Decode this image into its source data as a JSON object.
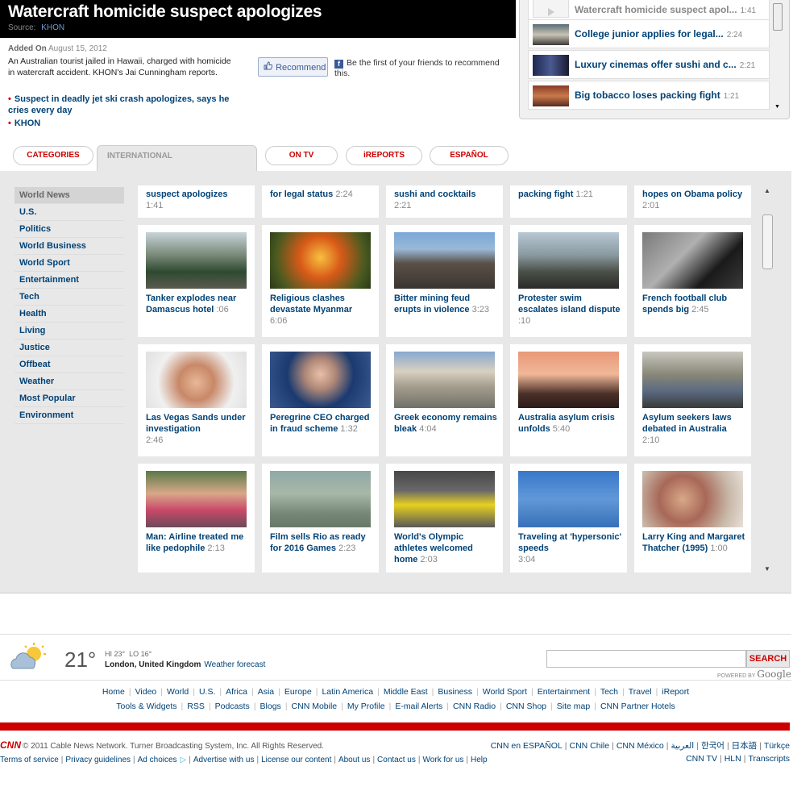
{
  "video": {
    "title": "Watercraft homicide suspect apologizes",
    "source_label": "Source:",
    "source": "KHON",
    "added_label": "Added On",
    "added_date": "August 15, 2012",
    "description": "An Australian tourist jailed in Hawaii, charged with homicide in watercraft accident. KHON's Jai Cunningham reports.",
    "related": [
      "Suspect in deadly jet ski crash apologizes, says he cries every day",
      "KHON"
    ],
    "recommend_label": "Recommend",
    "fb_text": "Be the first of your friends to recommend this."
  },
  "playlist": [
    {
      "title": "Watercraft homicide suspect apol...",
      "duration": "1:41"
    },
    {
      "title": "College junior applies for legal...",
      "duration": "2:24"
    },
    {
      "title": "Luxury cinemas offer sushi and c...",
      "duration": "2:21"
    },
    {
      "title": "Big tobacco loses packing fight",
      "duration": "1:21"
    }
  ],
  "tabs": [
    "CATEGORIES",
    "INTERNATIONAL",
    "ON TV",
    "iREPORTS",
    "ESPAÑOL"
  ],
  "side_nav": [
    "World News",
    "U.S.",
    "Politics",
    "World Business",
    "World Sport",
    "Entertainment",
    "Tech",
    "Health",
    "Living",
    "Justice",
    "Offbeat",
    "Weather",
    "Most Popular",
    "Environment"
  ],
  "partial_row": [
    {
      "title": "suspect apologizes",
      "duration": "1:41"
    },
    {
      "title": "for legal status",
      "duration": "2:24"
    },
    {
      "title": "sushi and cocktails",
      "duration": "2:21"
    },
    {
      "title": "packing fight",
      "duration": "1:21"
    },
    {
      "title": "hopes on Obama policy",
      "duration": "2:01"
    }
  ],
  "videos": [
    {
      "title": "Tanker explodes near Damascus hotel",
      "duration": ":06"
    },
    {
      "title": "Religious clashes devastate Myanmar",
      "duration": "6:06"
    },
    {
      "title": "Bitter mining feud erupts in violence",
      "duration": "3:23"
    },
    {
      "title": "Protester swim escalates island dispute",
      "duration": ":10"
    },
    {
      "title": "French football club spends big",
      "duration": "2:45"
    },
    {
      "title": "Las Vegas Sands under investigation",
      "duration": "2:46"
    },
    {
      "title": "Peregrine CEO charged in fraud scheme",
      "duration": "1:32"
    },
    {
      "title": "Greek economy remains bleak",
      "duration": "4:04"
    },
    {
      "title": "Australia asylum crisis unfolds",
      "duration": "5:40"
    },
    {
      "title": "Asylum seekers laws debated in Australia",
      "duration": "2:10"
    },
    {
      "title": "Man: Airline treated me like pedophile",
      "duration": "2:13"
    },
    {
      "title": "Film sells Rio as ready for 2016 Games",
      "duration": "2:23"
    },
    {
      "title": "World's Olympic athletes welcomed home",
      "duration": "2:03"
    },
    {
      "title": "Traveling at 'hypersonic' speeds",
      "duration": "3:04"
    },
    {
      "title": "Larry King and Margaret Thatcher (1995)",
      "duration": "1:00"
    }
  ],
  "weather": {
    "temp": "21°",
    "hi": "HI 23°",
    "lo": "LO 16°",
    "location": "London, United Kingdom",
    "forecast_link": "Weather forecast"
  },
  "search": {
    "button": "SEARCH",
    "powered": "POWERED BY",
    "google": "Google"
  },
  "footer_links_1": [
    "Home",
    "Video",
    "World",
    "U.S.",
    "Africa",
    "Asia",
    "Europe",
    "Latin America",
    "Middle East",
    "Business",
    "World Sport",
    "Entertainment",
    "Tech",
    "Travel",
    "iReport"
  ],
  "footer_links_2": [
    "Tools & Widgets",
    "RSS",
    "Podcasts",
    "Blogs",
    "CNN Mobile",
    "My Profile",
    "E-mail Alerts",
    "CNN Radio",
    "CNN Shop",
    "Site map",
    "CNN Partner Hotels"
  ],
  "copyright": {
    "logo": "CNN",
    "text": "© 2011 Cable News Network. Turner Broadcasting System, Inc. All Rights Reserved."
  },
  "intl_links": [
    "CNN en ESPAÑOL",
    "CNN Chile",
    "CNN México",
    "العربية",
    "한국어",
    "日本語",
    "Türkçe"
  ],
  "legal_links": [
    "Terms of service",
    "Privacy guidelines",
    "Ad choices",
    "Advertise with us",
    "License our content",
    "About us",
    "Contact us",
    "Work for us",
    "Help"
  ],
  "tv_links": [
    "CNN TV",
    "HLN",
    "Transcripts"
  ],
  "colors": {
    "brand_red": "#cc0000",
    "link_blue": "#004276",
    "gallery_bg": "#e8e8e8"
  }
}
